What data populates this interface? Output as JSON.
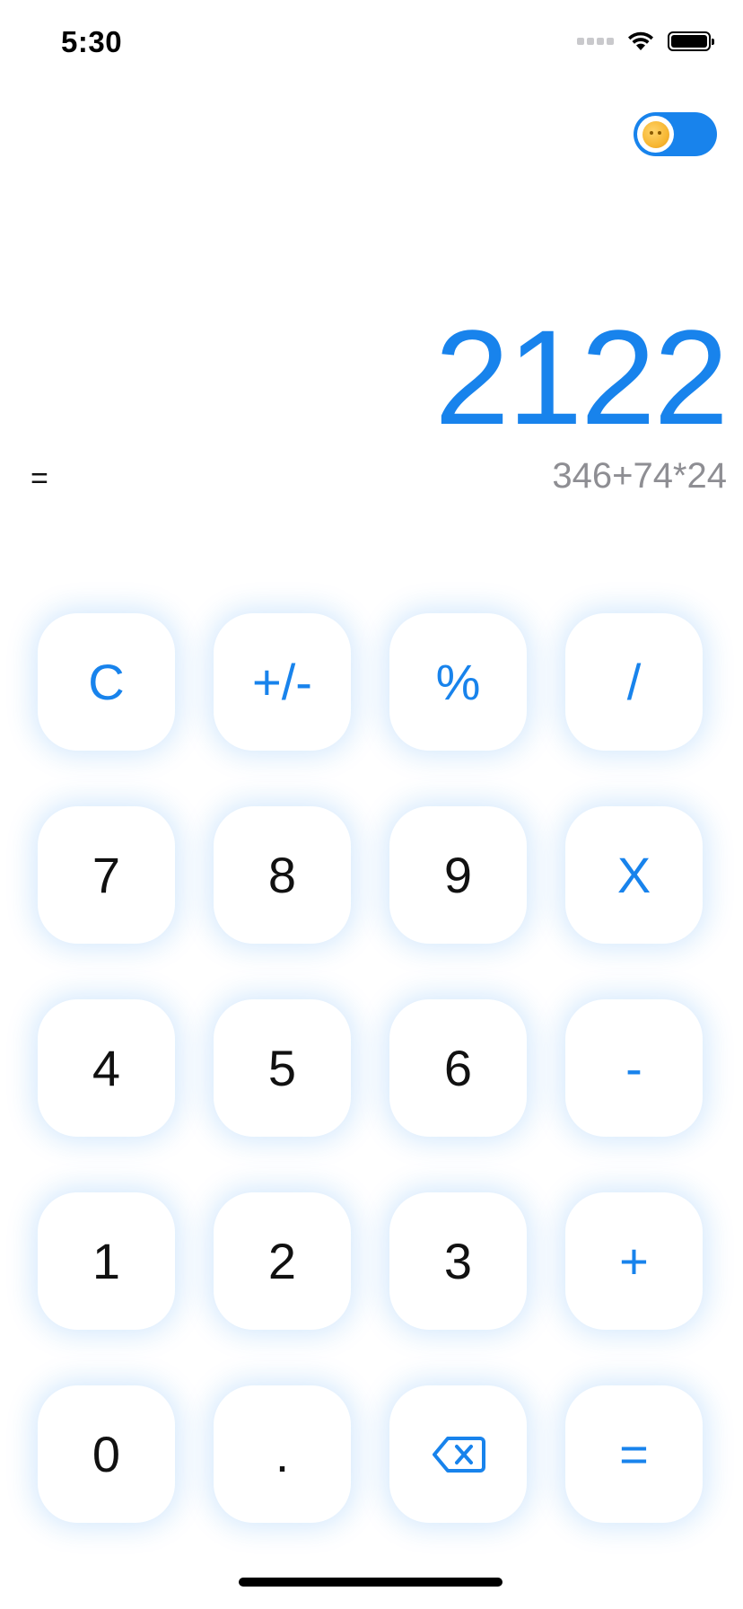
{
  "status_bar": {
    "time": "5:30",
    "wifi_icon": "wifi-icon",
    "battery_icon": "battery-icon"
  },
  "theme_toggle": {
    "state": "on",
    "icon": "sun-face-icon",
    "color": "#1883ec"
  },
  "display": {
    "result": "2122",
    "equals": "=",
    "expression": "346+74*24",
    "result_color": "#1883ec",
    "expression_color": "#8e8e93"
  },
  "keypad": {
    "clear": "C",
    "sign": "+/-",
    "percent": "%",
    "divide": "/",
    "seven": "7",
    "eight": "8",
    "nine": "9",
    "multiply": "X",
    "four": "4",
    "five": "5",
    "six": "6",
    "subtract": "-",
    "one": "1",
    "two": "2",
    "three": "3",
    "add": "+",
    "zero": "0",
    "decimal": ".",
    "backspace_icon": "backspace-icon",
    "equals": "="
  },
  "colors": {
    "accent": "#1883ec",
    "digit": "#111111",
    "background": "#ffffff"
  }
}
